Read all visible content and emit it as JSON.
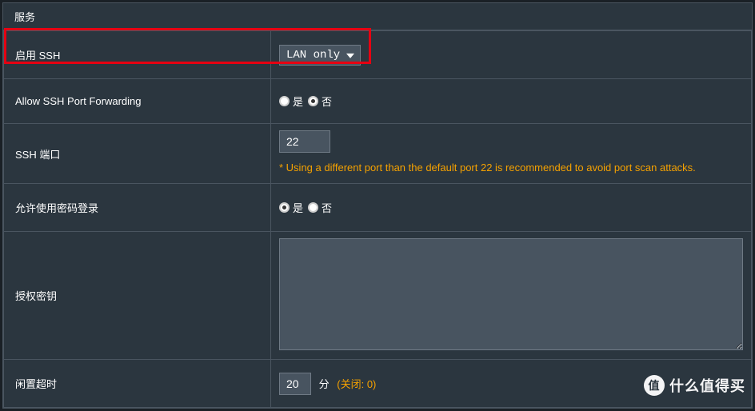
{
  "panel": {
    "title": "服务"
  },
  "rows": {
    "enable_ssh": {
      "label": "启用 SSH",
      "selected": "LAN only",
      "options": [
        "LAN only"
      ]
    },
    "port_forwarding": {
      "label": "Allow SSH Port Forwarding",
      "yes": "是",
      "no": "否",
      "value": "no"
    },
    "ssh_port": {
      "label": "SSH 端口",
      "value": "22",
      "hint": "* Using a different port than the default port 22 is recommended to avoid port scan attacks."
    },
    "password_login": {
      "label": "允许使用密码登录",
      "yes": "是",
      "no": "否",
      "value": "yes"
    },
    "auth_key": {
      "label": "授权密钥",
      "value": ""
    },
    "idle_timeout": {
      "label": "闲置超时",
      "value": "20",
      "unit": "分",
      "closed_label": "(关闭: 0)"
    }
  },
  "watermark": {
    "badge": "值",
    "text": "什么值得买"
  }
}
